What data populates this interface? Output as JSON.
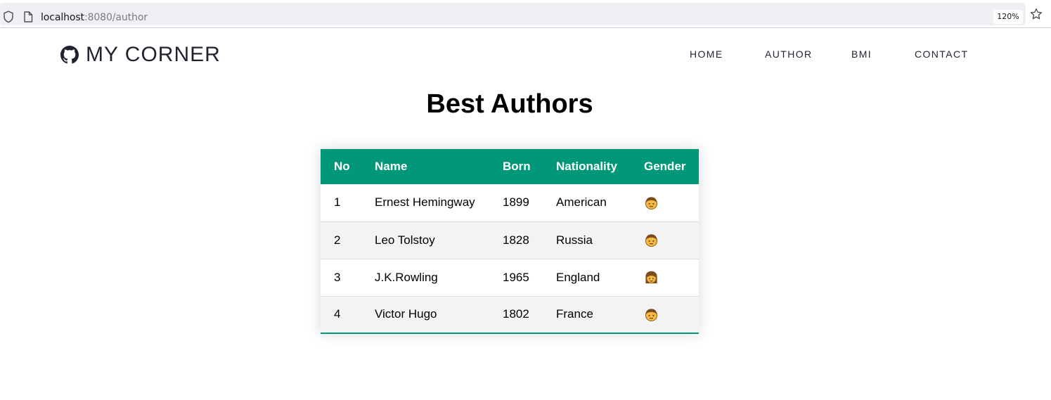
{
  "browser": {
    "url_host": "localhost",
    "url_rest": ":8080/author",
    "zoom": "120%",
    "icons": [
      "shield-icon",
      "page-icon",
      "star-icon"
    ]
  },
  "nav": {
    "brand": "MY CORNER",
    "brand_icon": "github-icon",
    "links": [
      "HOME",
      "AUTHOR",
      "BMI",
      "CONTACT"
    ]
  },
  "page": {
    "title": "Best Authors"
  },
  "table": {
    "headers": [
      "No",
      "Name",
      "Born",
      "Nationality",
      "Gender"
    ],
    "rows": [
      {
        "no": "1",
        "name": "Ernest Hemingway",
        "born": "1899",
        "nationality": "American",
        "gender": "male"
      },
      {
        "no": "2",
        "name": "Leo Tolstoy",
        "born": "1828",
        "nationality": "Russia",
        "gender": "male"
      },
      {
        "no": "3",
        "name": "J.K.Rowling",
        "born": "1965",
        "nationality": "England",
        "gender": "female"
      },
      {
        "no": "4",
        "name": "Victor Hugo",
        "born": "1802",
        "nationality": "France",
        "gender": "male"
      }
    ]
  },
  "colors": {
    "accent": "#009879",
    "stripe": "#f3f3f3"
  }
}
